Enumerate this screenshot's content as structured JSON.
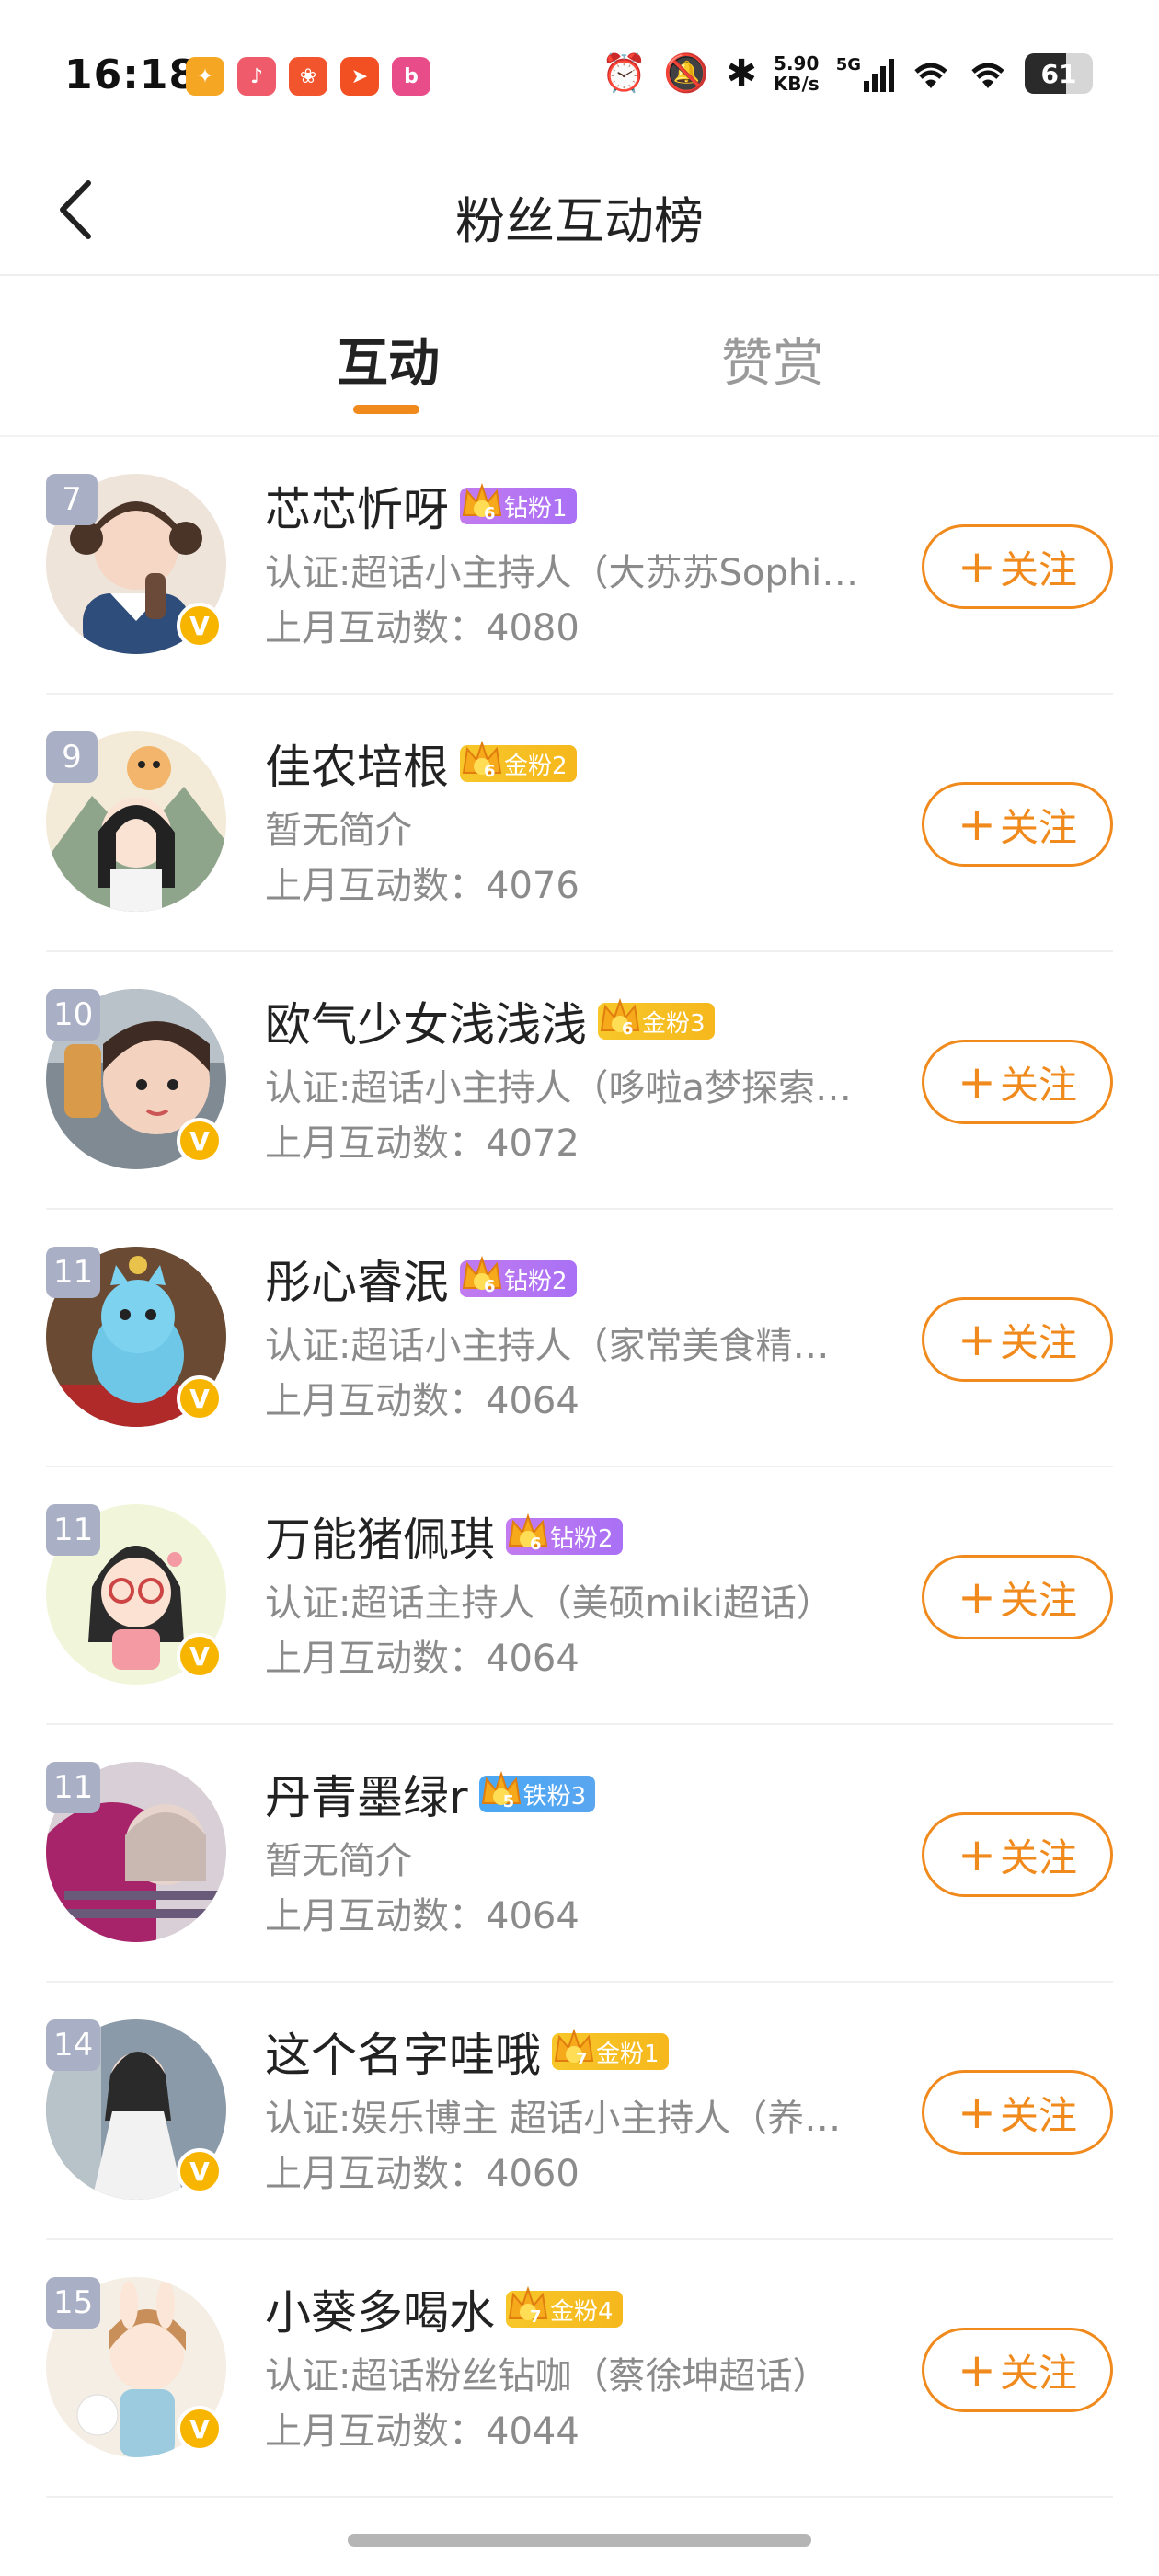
{
  "status_bar": {
    "time": "16:18",
    "app_icons": [
      {
        "name": "app-icon-1",
        "color": "#f5a623",
        "glyph": "✦"
      },
      {
        "name": "app-icon-2",
        "color": "#ef5b6a",
        "glyph": "♪"
      },
      {
        "name": "app-icon-3",
        "color": "#f2542d",
        "glyph": "❀"
      },
      {
        "name": "app-icon-4",
        "color": "#f25022",
        "glyph": "➤"
      },
      {
        "name": "app-icon-5",
        "color": "#e84d8a",
        "glyph": "b"
      }
    ],
    "net_speed_value": "5.90",
    "net_speed_unit": "KB/s",
    "network": "5G",
    "battery": "61"
  },
  "header": {
    "title": "粉丝互动榜"
  },
  "tabs": [
    {
      "label": "互动",
      "active": true
    },
    {
      "label": "赞赏",
      "active": false
    }
  ],
  "follow_label": "关注",
  "follow_plus": "+",
  "accent_color": "#f08a1d",
  "fans": [
    {
      "rank": "7",
      "name": "芯芯忻呀",
      "badge_text": "钻粉1",
      "badge_type": "diamond",
      "badge_level": "6",
      "verified": true,
      "desc": "认证:超话小主持人（大苏苏Sophi…",
      "count": "上月互动数：4080"
    },
    {
      "rank": "9",
      "name": "佳农培根",
      "badge_text": "金粉2",
      "badge_type": "gold",
      "badge_level": "6",
      "verified": false,
      "desc": "暂无简介",
      "count": "上月互动数：4076"
    },
    {
      "rank": "10",
      "name": "欧气少女浅浅浅",
      "badge_text": "金粉3",
      "badge_type": "gold",
      "badge_level": "6",
      "verified": true,
      "desc": "认证:超话小主持人（哆啦a梦探索…",
      "count": "上月互动数：4072"
    },
    {
      "rank": "11",
      "name": "彤心睿泯",
      "badge_text": "钻粉2",
      "badge_type": "diamond",
      "badge_level": "6",
      "verified": true,
      "desc": "认证:超话小主持人（家常美食精…",
      "count": "上月互动数：4064"
    },
    {
      "rank": "11",
      "name": "万能猪佩琪",
      "badge_text": "钻粉2",
      "badge_type": "diamond",
      "badge_level": "6",
      "verified": true,
      "desc": "认证:超话主持人（美硕miki超话）",
      "count": "上月互动数：4064"
    },
    {
      "rank": "11",
      "name": "丹青墨绿r",
      "badge_text": "铁粉3",
      "badge_type": "iron",
      "badge_level": "5",
      "verified": false,
      "desc": "暂无简介",
      "count": "上月互动数：4064"
    },
    {
      "rank": "14",
      "name": "这个名字哇哦",
      "badge_text": "金粉1",
      "badge_type": "gold",
      "badge_level": "7",
      "verified": true,
      "desc": "认证:娱乐博主 超话小主持人（养…",
      "count": "上月互动数：4060"
    },
    {
      "rank": "15",
      "name": "小葵多喝水",
      "badge_text": "金粉4",
      "badge_type": "gold",
      "badge_level": "7",
      "verified": true,
      "desc": "认证:超话粉丝钻咖（蔡徐坤超话）",
      "count": "上月互动数：4044"
    }
  ]
}
